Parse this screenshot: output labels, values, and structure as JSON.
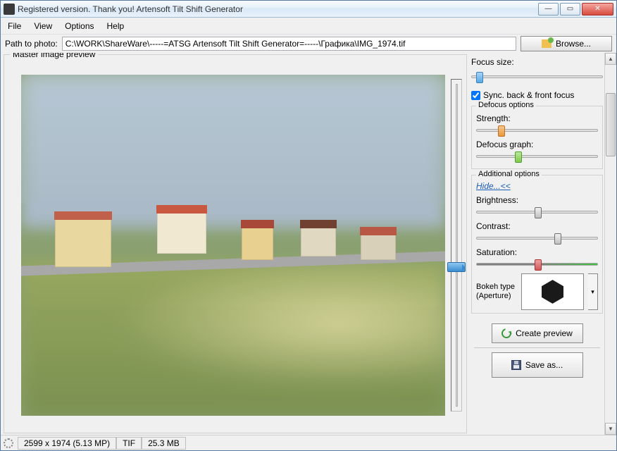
{
  "titlebar": {
    "title": "Registered version. Thank you! Artensoft Tilt Shift Generator"
  },
  "menu": {
    "file": "File",
    "view": "View",
    "options": "Options",
    "help": "Help"
  },
  "pathbar": {
    "label": "Path to photo:",
    "value": "C:\\WORK\\ShareWare\\-----=ATSG Artensoft Tilt Shift Generator=-----\\Графика\\IMG_1974.tif",
    "browse": "Browse..."
  },
  "preview": {
    "legend": "Master image preview"
  },
  "settings": {
    "focus_size": "Focus size:",
    "sync": "Sync. back & front focus",
    "defocus_legend": "Defocus options",
    "strength": "Strength:",
    "defocus_graph": "Defocus graph:",
    "additional_legend": "Additional options",
    "hide": "Hide...<<",
    "brightness": "Brightness:",
    "contrast": "Contrast:",
    "saturation": "Saturation:",
    "bokeh_label": "Bokeh type (Aperture)"
  },
  "actions": {
    "create_preview": "Create preview",
    "save_as": "Save as..."
  },
  "status": {
    "dims": "2599 x 1974 (5.13 MP)",
    "fmt": "TIF",
    "size": "25.3 MB"
  },
  "slider_pos": {
    "focus": 4,
    "strength": 18,
    "defocus_graph": 32,
    "brightness": 48,
    "contrast": 64,
    "saturation": 48,
    "preview_v": 55
  }
}
